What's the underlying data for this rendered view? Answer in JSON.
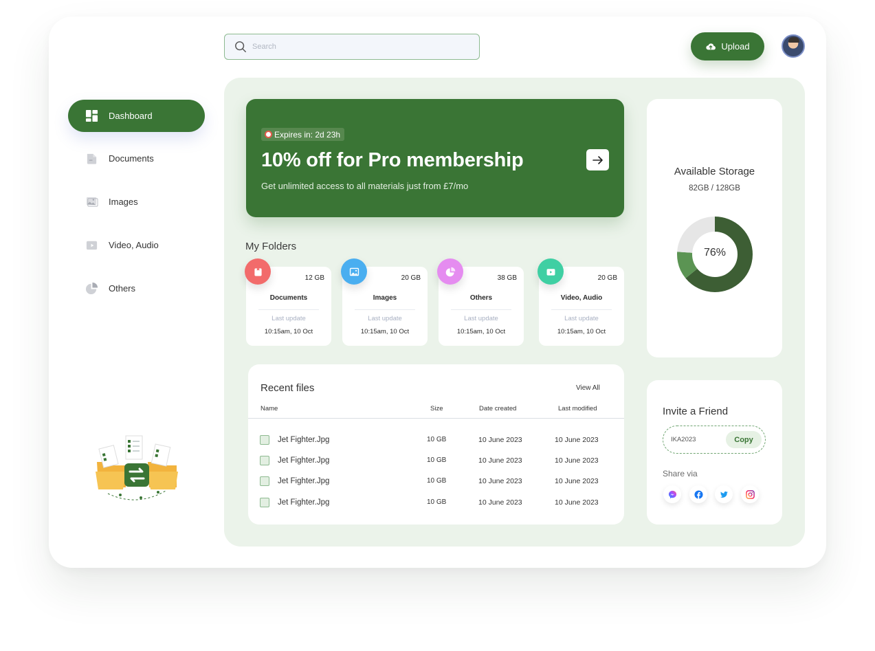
{
  "search": {
    "placeholder": "Search"
  },
  "header": {
    "upload_label": "Upload"
  },
  "sidebar": {
    "items": [
      {
        "label": "Dashboard",
        "icon": "dashboard-icon",
        "active": true
      },
      {
        "label": "Documents",
        "icon": "document-icon"
      },
      {
        "label": "Images",
        "icon": "image-icon"
      },
      {
        "label": "Video, Audio",
        "icon": "video-icon"
      },
      {
        "label": "Others",
        "icon": "pie-icon"
      }
    ]
  },
  "promo": {
    "badge": "Expires in: 2d 23h",
    "title": "10% off for Pro membership",
    "subtitle": "Get unlimited access to all materials just from  £7/mo"
  },
  "folders": {
    "title": "My Folders",
    "items": [
      {
        "name": "Documents",
        "size": "12 GB",
        "last_update_label": "Last update",
        "last_update": "10:15am, 10 Oct",
        "color": "#f26b6b",
        "icon": "document-icon"
      },
      {
        "name": "Images",
        "size": "20 GB",
        "last_update_label": "Last update",
        "last_update": "10:15am, 10 Oct",
        "color": "#4aaef0",
        "icon": "image-icon"
      },
      {
        "name": "Others",
        "size": "38 GB",
        "last_update_label": "Last update",
        "last_update": "10:15am, 10 Oct",
        "color": "#e58cf0",
        "icon": "pie-icon"
      },
      {
        "name": "Video, Audio",
        "size": "20 GB",
        "last_update_label": "Last update",
        "last_update": "10:15am, 10 Oct",
        "color": "#3fcfa3",
        "icon": "video-icon"
      }
    ]
  },
  "recent": {
    "title": "Recent files",
    "view_all": "View All",
    "columns": [
      "Name",
      "Size",
      "Date created",
      "Last modified"
    ],
    "rows": [
      {
        "name": "Jet Fighter.Jpg",
        "size": "10 GB",
        "created": "10 June 2023",
        "modified": "10 June 2023"
      },
      {
        "name": "Jet Fighter.Jpg",
        "size": "10 GB",
        "created": "10 June 2023",
        "modified": "10 June 2023"
      },
      {
        "name": "Jet Fighter.Jpg",
        "size": "10 GB",
        "created": "10 June 2023",
        "modified": "10 June 2023"
      },
      {
        "name": "Jet Fighter.Jpg",
        "size": "10 GB",
        "created": "10 June 2023",
        "modified": "10 June 2023"
      }
    ]
  },
  "storage": {
    "title": "Available Storage",
    "value": "82GB / 128GB",
    "percent_label": "76%",
    "segments": [
      {
        "fraction": 0.64,
        "color": "#3d5e34"
      },
      {
        "fraction": 0.12,
        "color": "#5b9453"
      },
      {
        "fraction": 0.24,
        "color": "#e6e6e6"
      }
    ]
  },
  "invite": {
    "title": "Invite a Friend",
    "code": "IKA2023",
    "copy_label": "Copy",
    "share_label": "Share via",
    "socials": [
      "messenger-icon",
      "facebook-icon",
      "twitter-icon",
      "instagram-icon"
    ]
  },
  "colors": {
    "accent": "#3a7535",
    "panel": "#ebf3ea"
  }
}
